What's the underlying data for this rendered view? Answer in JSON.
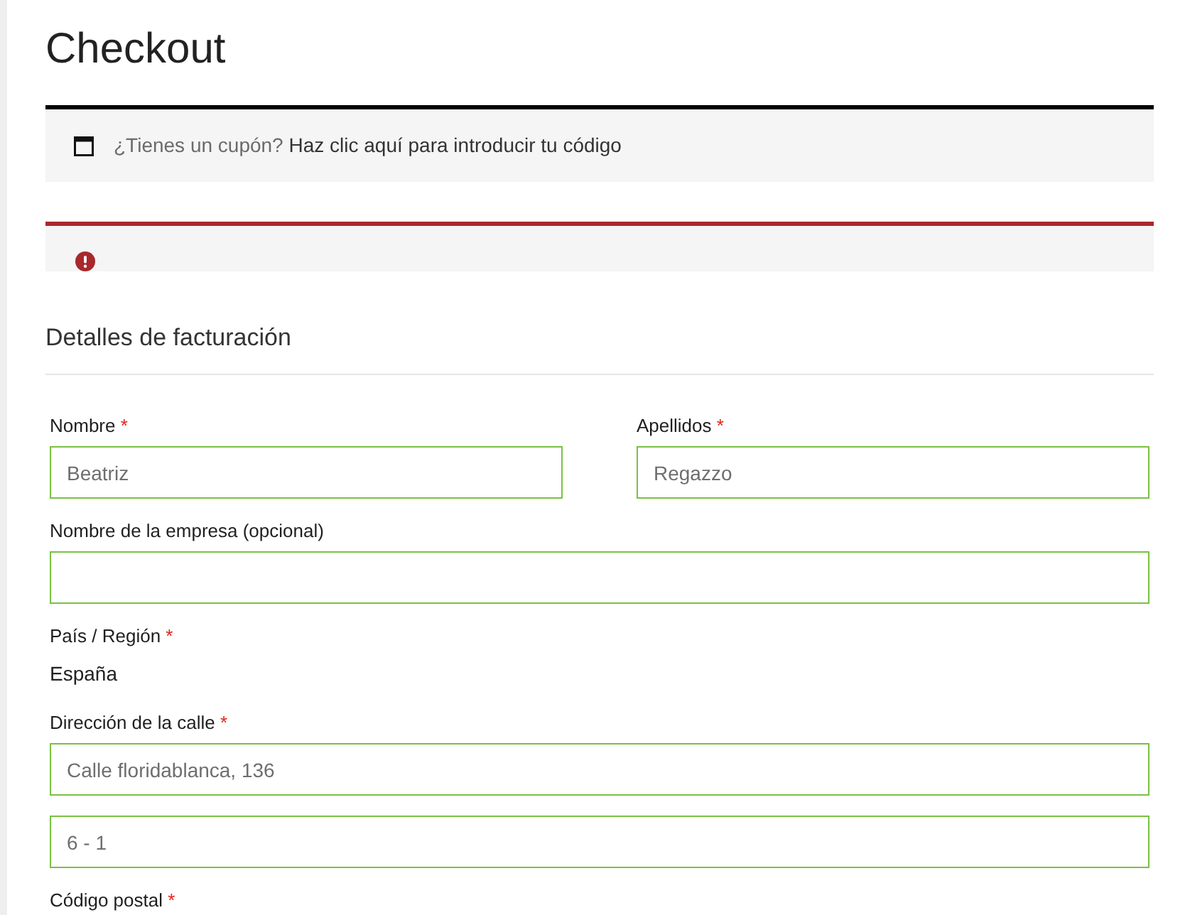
{
  "page": {
    "title": "Checkout"
  },
  "notices": [
    {
      "kind": "info",
      "question": "¿Tienes un cupón?",
      "link": "Haz clic aquí para introducir tu código"
    },
    {
      "kind": "error"
    }
  ],
  "billing": {
    "heading": "Detalles de facturación",
    "rows": [
      {
        "fields": [
          {
            "label": "Nombre",
            "required_mark": "*",
            "control": {
              "kind": "input",
              "value": "Beatriz",
              "validated": true
            }
          },
          {
            "label": "Apellidos",
            "required_mark": "*",
            "control": {
              "kind": "input",
              "value": "Regazzo",
              "validated": true
            }
          }
        ]
      },
      {
        "fields": [
          {
            "label": "Nombre de la empresa (opcional)",
            "control": {
              "kind": "input",
              "validated": true
            }
          }
        ]
      },
      {
        "fields": [
          {
            "label": "País / Región",
            "required_mark": "*",
            "control": {
              "kind": "text",
              "value": "España"
            }
          }
        ]
      },
      {
        "fields": [
          {
            "label": "Dirección de la calle",
            "required_mark": "*",
            "control": {
              "kind": "input",
              "value": "Calle floridablanca, 136",
              "validated": true
            }
          }
        ]
      },
      {
        "fields": [
          {
            "control": {
              "kind": "input",
              "value": "6 - 1",
              "validated": true
            }
          }
        ]
      },
      {
        "fields": [
          {
            "label": "Código postal",
            "required_mark": "*"
          }
        ]
      }
    ]
  }
}
